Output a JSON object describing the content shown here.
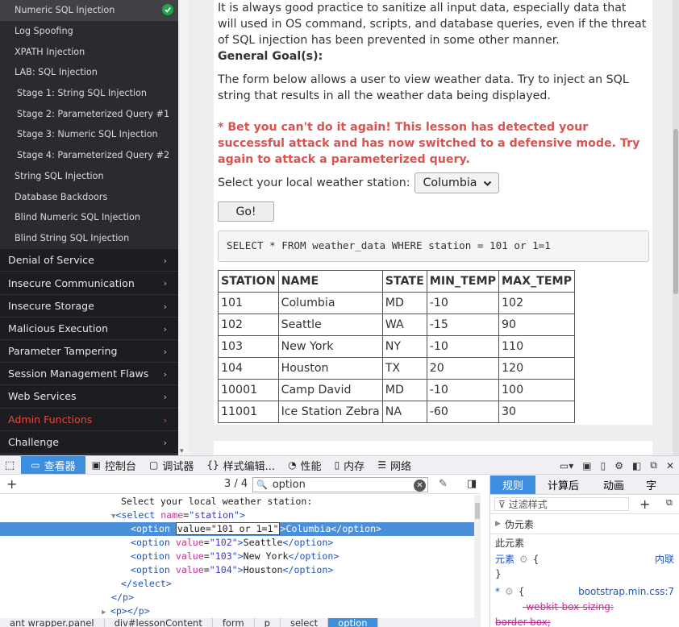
{
  "sidebar": {
    "sub_items": [
      {
        "label": "Numeric SQL Injection",
        "active": true,
        "completed": true
      },
      {
        "label": "Log Spoofing"
      },
      {
        "label": "XPATH Injection"
      },
      {
        "label": "LAB: SQL Injection"
      },
      {
        "label": "Stage 1: String SQL Injection",
        "stage": true
      },
      {
        "label": "Stage 2: Parameterized Query #1",
        "stage": true
      },
      {
        "label": "Stage 3: Numeric SQL Injection",
        "stage": true
      },
      {
        "label": "Stage 4: Parameterized Query #2",
        "stage": true
      },
      {
        "label": "String SQL Injection"
      },
      {
        "label": "Database Backdoors"
      },
      {
        "label": "Blind Numeric SQL Injection"
      },
      {
        "label": "Blind String SQL Injection"
      }
    ],
    "categories": [
      {
        "label": "Denial of Service"
      },
      {
        "label": "Insecure Communication"
      },
      {
        "label": "Insecure Storage"
      },
      {
        "label": "Malicious Execution"
      },
      {
        "label": "Parameter Tampering"
      },
      {
        "label": "Session Management Flaws"
      },
      {
        "label": "Web Services"
      },
      {
        "label": "Admin Functions",
        "highlight": true
      },
      {
        "label": "Challenge"
      }
    ]
  },
  "lesson": {
    "intro": "It is always good practice to sanitize all input data, especially data that will used in OS command, scripts, and database queries, even if the threat of SQL injection has been prevented in some other manner.",
    "goal_heading": "General Goal(s):",
    "goal_text": "The form below allows a user to view weather data. Try to inject an SQL string that results in all the weather data being displayed.",
    "warning": "* Bet you can't do it again! This lesson has detected your successful attack and has now switched to a defensive mode. Try again to attack a parameterized query.",
    "station_label": "Select your local weather station:",
    "station_value": "Columbia",
    "go_label": "Go!",
    "sql_query": "SELECT * FROM weather_data WHERE station = 101 or 1=1",
    "table": {
      "headers": [
        "STATION",
        "NAME",
        "STATE",
        "MIN_TEMP",
        "MAX_TEMP"
      ],
      "rows": [
        [
          "101",
          "Columbia",
          "MD",
          "-10",
          "102"
        ],
        [
          "102",
          "Seattle",
          "WA",
          "-15",
          "90"
        ],
        [
          "103",
          "New York",
          "NY",
          "-10",
          "110"
        ],
        [
          "104",
          "Houston",
          "TX",
          "20",
          "120"
        ],
        [
          "10001",
          "Camp David",
          "MD",
          "-10",
          "100"
        ],
        [
          "11001",
          "Ice Station Zebra",
          "NA",
          "-60",
          "30"
        ]
      ]
    }
  },
  "devtools": {
    "tabs": [
      {
        "label": "查看器",
        "icon": "inspector-icon",
        "active": true
      },
      {
        "label": "控制台",
        "icon": "console-icon"
      },
      {
        "label": "调试器",
        "icon": "debugger-icon"
      },
      {
        "label": "样式编辑...",
        "icon": "style-editor-icon"
      },
      {
        "label": "性能",
        "icon": "performance-icon"
      },
      {
        "label": "内存",
        "icon": "memory-icon"
      },
      {
        "label": "网络",
        "icon": "network-icon"
      }
    ],
    "search_count": "3 / 4",
    "search_value": "option",
    "markup": {
      "text_line": "Select your local weather station:",
      "select_open": {
        "tag": "select",
        "attr": "name",
        "value": "station"
      },
      "selected_option": {
        "before": "<option ",
        "edit": "value=\"101 or 1=1\"",
        "after": ">Columbia</option>"
      },
      "options": [
        {
          "value": "\"102\"",
          "text": "Seattle"
        },
        {
          "value": "\"103\"",
          "text": "New York"
        },
        {
          "value": "\"104\"",
          "text": "Houston"
        }
      ],
      "close_select": "</select>",
      "close_p": "</p>",
      "p_empty": "<p></p>"
    },
    "breadcrumbs": [
      "ant wrapper.panel",
      "div#lessonContent",
      "form",
      "p",
      "select",
      "option"
    ],
    "rules_tabs": [
      {
        "label": "规则",
        "active": true
      },
      {
        "label": "计算后"
      },
      {
        "label": "动画"
      },
      {
        "label": "字"
      }
    ],
    "filter_placeholder": "过滤样式",
    "pseudo_label": "伪元素",
    "this_element": "此元素",
    "element_rule": "元素",
    "inline_label": "内联",
    "universal_selector": "*",
    "bootstrap_source": "bootstrap.min.css:7",
    "webkit_prop": "-webkit-box-sizing:",
    "border_prop": "border-box;"
  }
}
